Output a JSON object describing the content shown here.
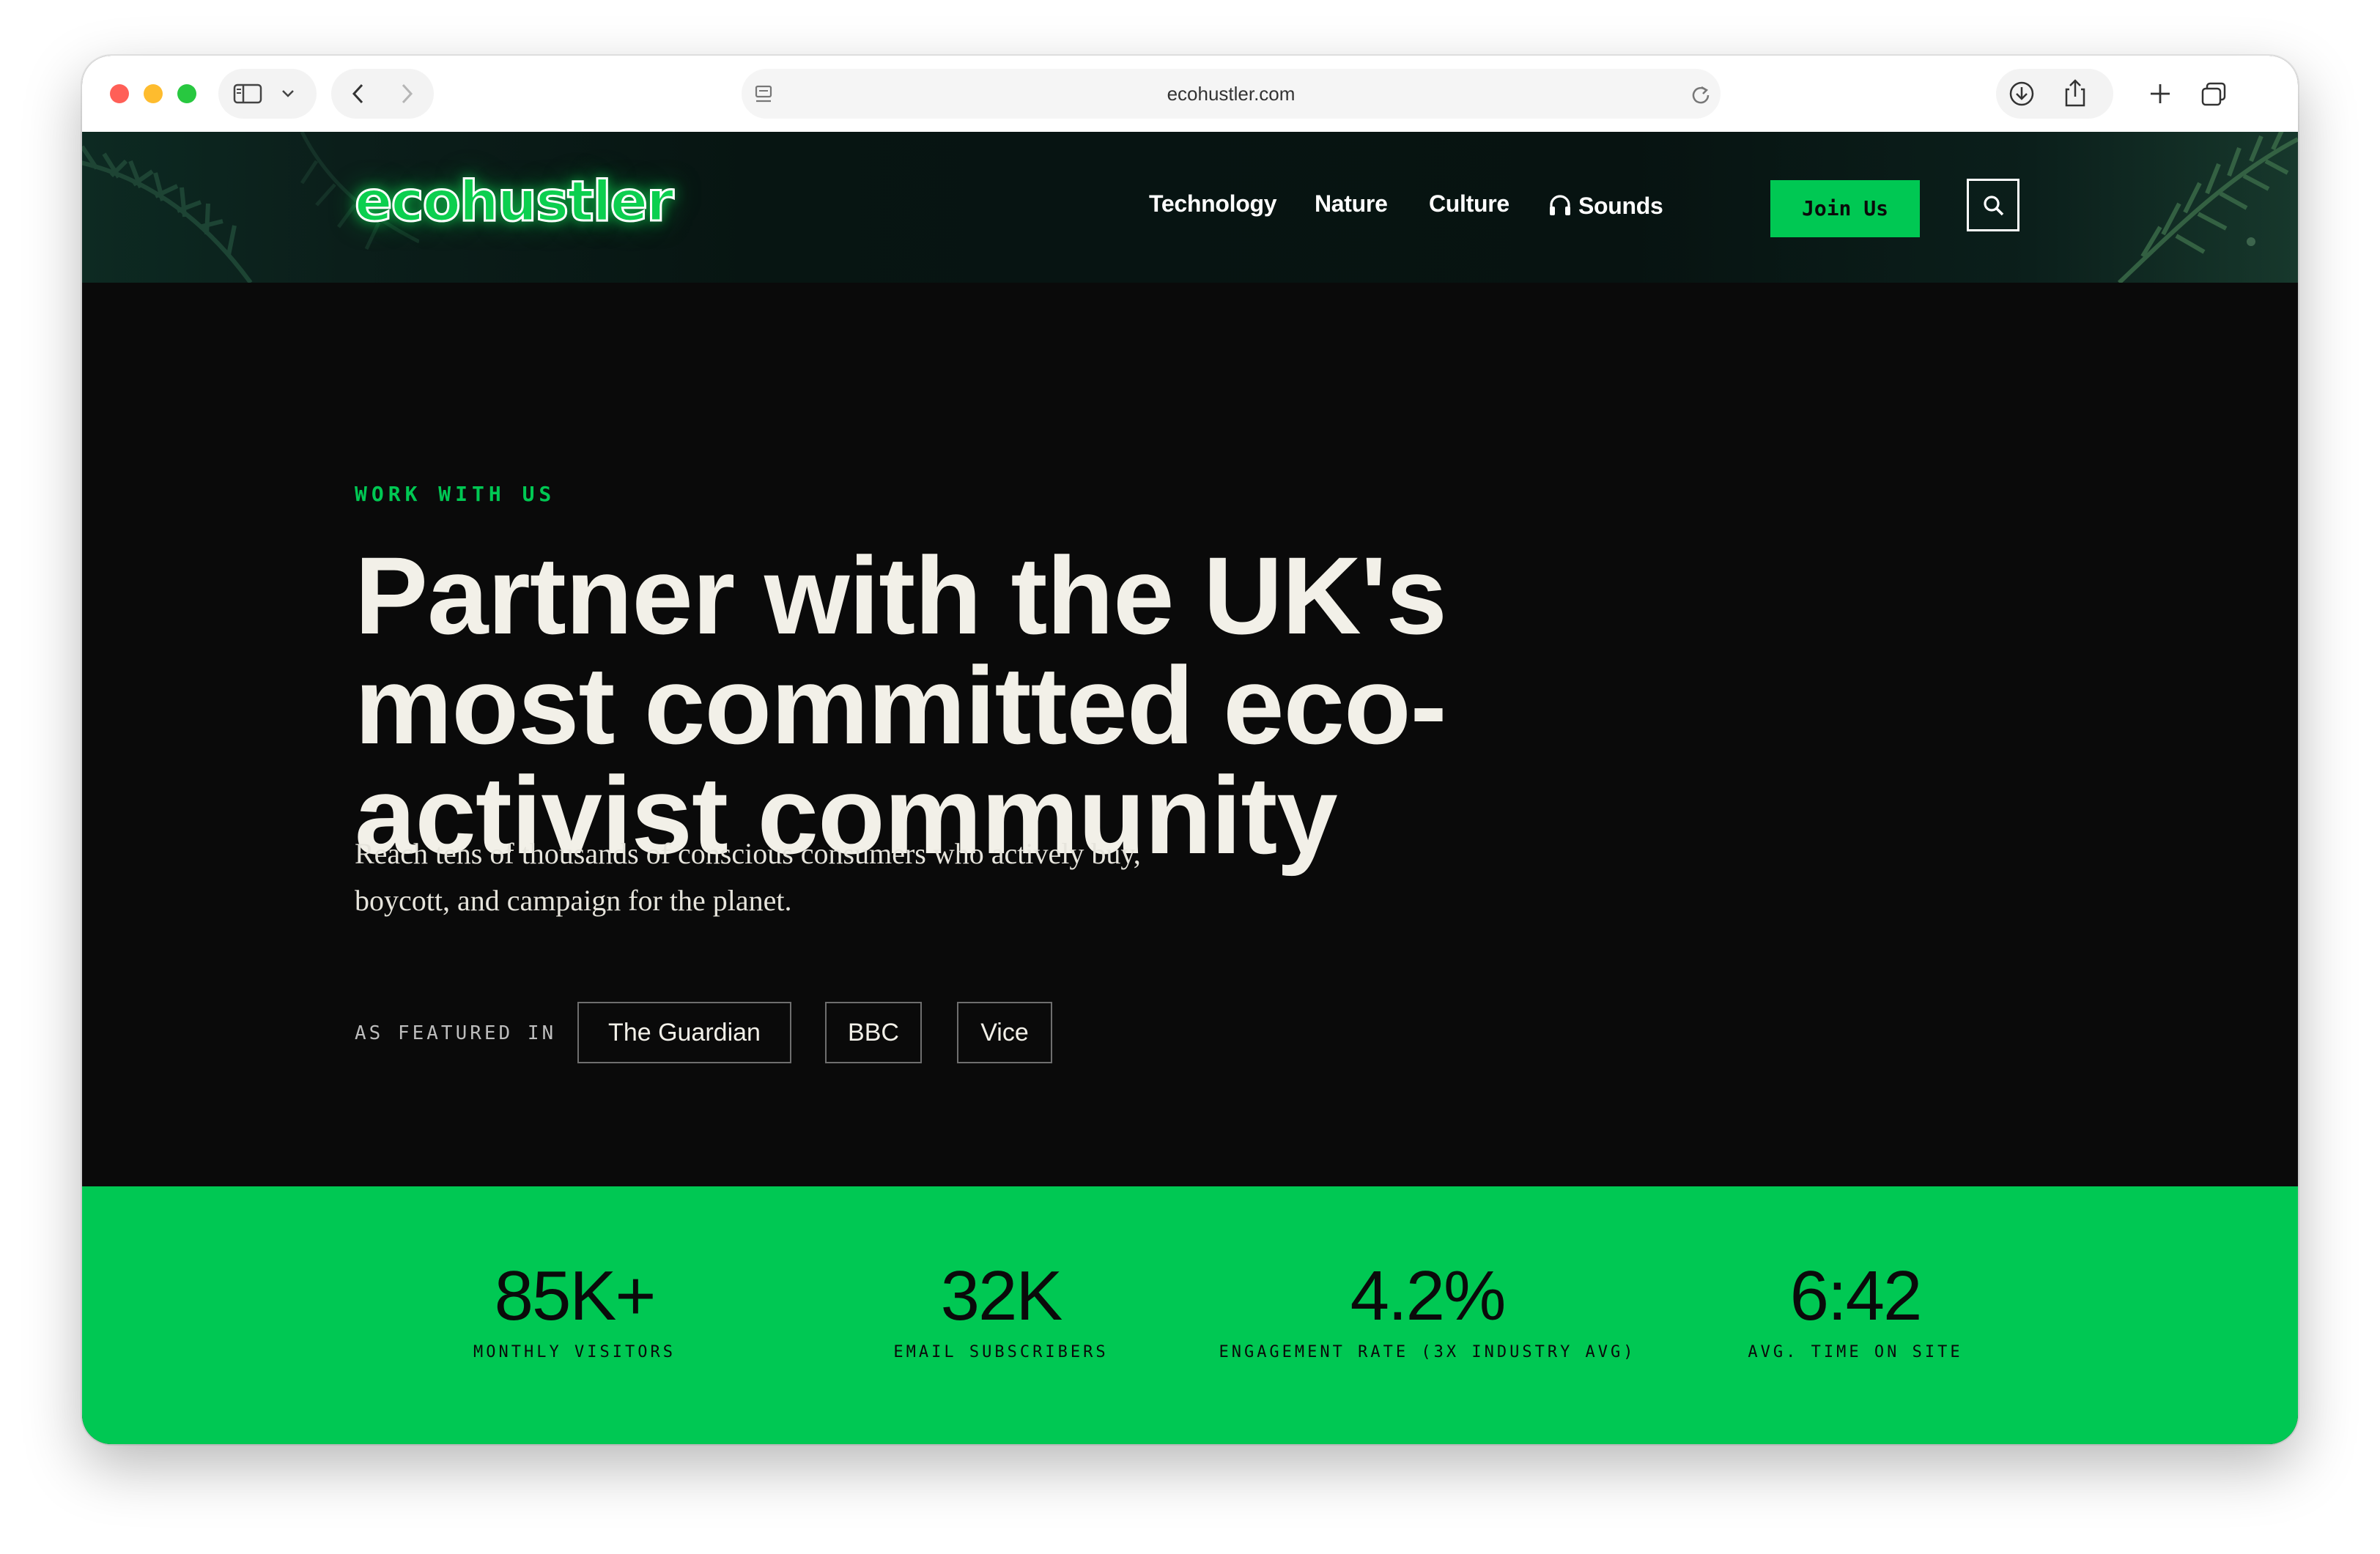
{
  "browser": {
    "url": "ecohustler.com"
  },
  "header": {
    "logo": "ecohustler",
    "nav": [
      "Technology",
      "Nature",
      "Culture",
      "Sounds"
    ],
    "join_label": "Join Us"
  },
  "hero": {
    "eyebrow": "WORK WITH US",
    "headline_lines": [
      "Partner with the UK's",
      "most committed eco-",
      "activist community"
    ],
    "subtext_lines": [
      "Reach tens of thousands of conscious consumers who actively buy,",
      "boycott, and campaign for the planet."
    ],
    "featured_label": "AS FEATURED IN",
    "outlets": [
      "The Guardian",
      "BBC",
      "Vice"
    ]
  },
  "stats": [
    {
      "value": "85K+",
      "label": "MONTHLY VISITORS"
    },
    {
      "value": "32K",
      "label": "EMAIL SUBSCRIBERS"
    },
    {
      "value": "4.2%",
      "label": "ENGAGEMENT RATE (3X INDUSTRY AVG)"
    },
    {
      "value": "6:42",
      "label": "AVG. TIME ON SITE"
    }
  ],
  "colors": {
    "accent_green": "#00c853",
    "hero_background": "#0a0a0a",
    "headline_text": "#f2f0e8"
  },
  "icons": [
    "sidebar-icon",
    "chevron-down-icon",
    "back-icon",
    "forward-icon",
    "page-icon",
    "reload-icon",
    "download-icon",
    "share-icon",
    "new-tab-icon",
    "tabs-overview-icon",
    "headphones-icon",
    "search-icon",
    "leaf-decoration"
  ]
}
